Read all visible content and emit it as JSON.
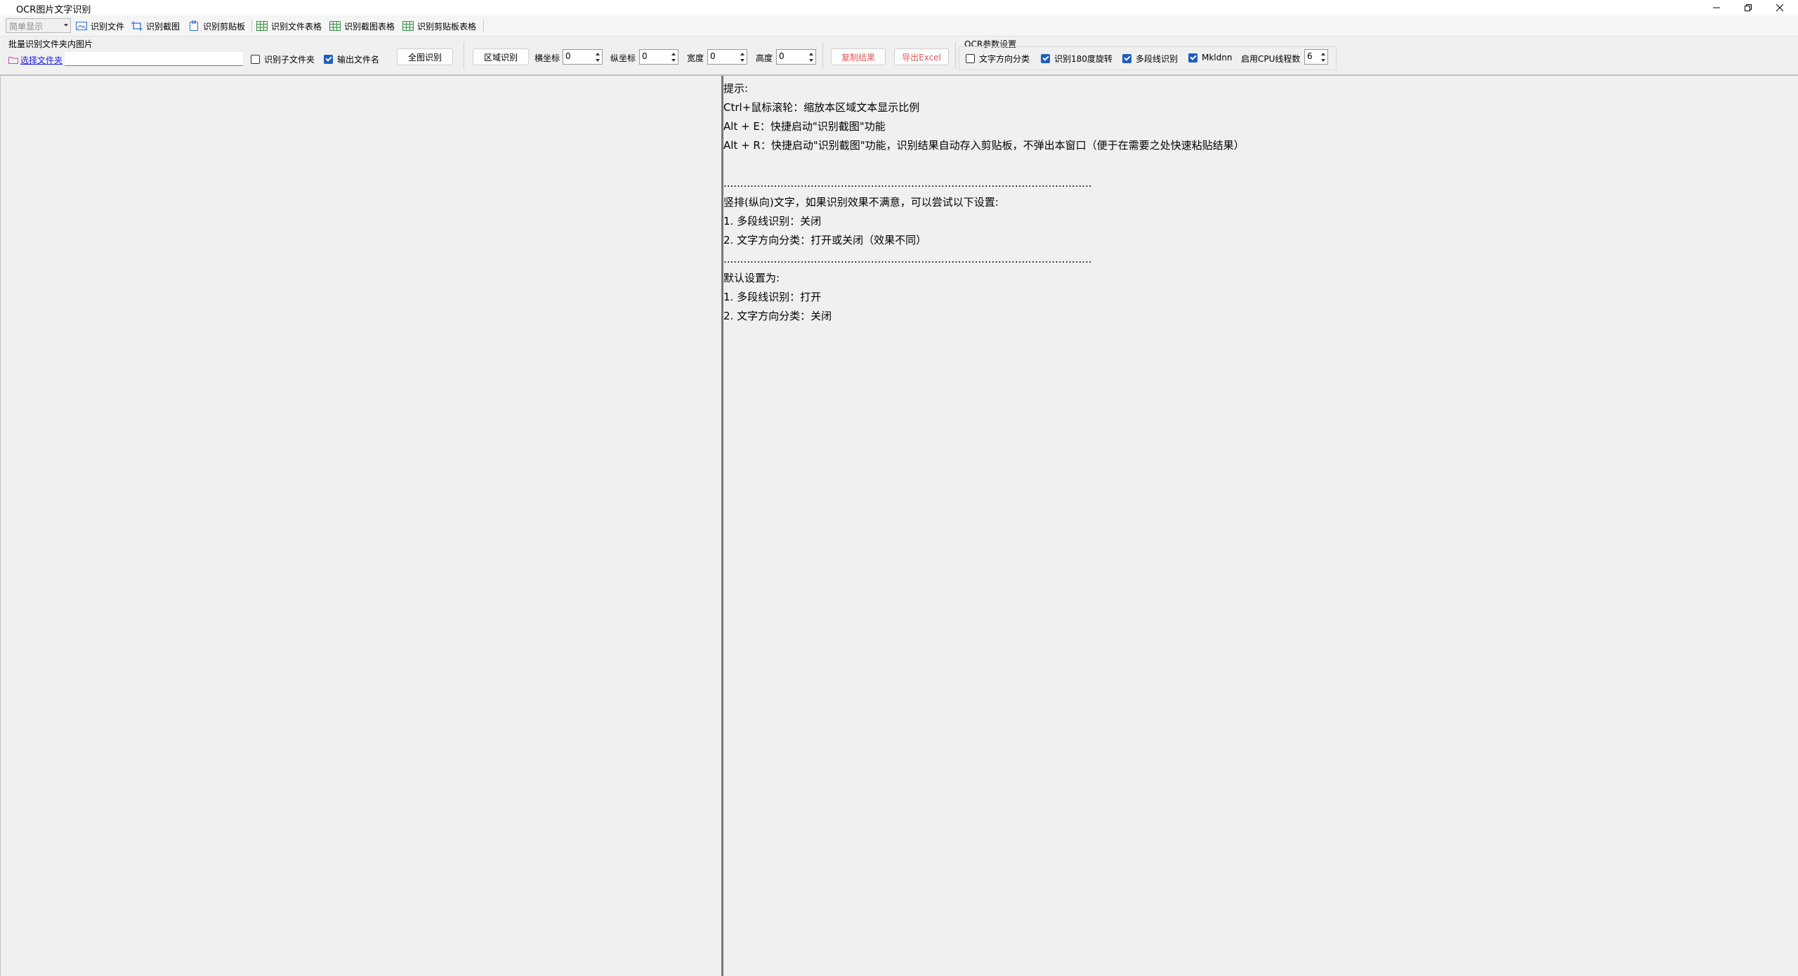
{
  "window": {
    "title": "OCR图片文字识别"
  },
  "toolbar": {
    "mode_select": "简单显示",
    "items": [
      {
        "label": "识别文件",
        "icon": "image-file-icon"
      },
      {
        "label": "识别截图",
        "icon": "screenshot-crop-icon"
      },
      {
        "label": "识别剪贴板",
        "icon": "clipboard-icon"
      },
      {
        "label": "识别文件表格",
        "icon": "table-icon"
      },
      {
        "label": "识别截图表格",
        "icon": "table-icon"
      },
      {
        "label": "识别剪贴板表格",
        "icon": "table-icon"
      }
    ]
  },
  "batch": {
    "group_label": "批量识别文件夹内图片",
    "choose_folder": "选择文件夹",
    "path_value": "",
    "include_subfolders": {
      "label": "识别子文件夹",
      "checked": false
    },
    "output_filename": {
      "label": "输出文件名",
      "checked": true
    },
    "recognize_all": "全图识别"
  },
  "region": {
    "button": "区域识别",
    "x_label": "横坐标",
    "x_value": "0",
    "y_label": "纵坐标",
    "y_value": "0",
    "w_label": "宽度",
    "w_value": "0",
    "h_label": "高度",
    "h_value": "0"
  },
  "actions": {
    "copy_result": "复制结果",
    "export_excel": "导出Excel"
  },
  "ocr_params": {
    "group_label": "OCR参数设置",
    "text_direction": {
      "label": "文字方向分类",
      "checked": false
    },
    "rotate180": {
      "label": "识别180度旋转",
      "checked": true
    },
    "multiline": {
      "label": "多段线识别",
      "checked": true
    },
    "mkldnn": {
      "label": "Mkldnn",
      "checked": true
    },
    "cpu_threads_label": "启用CPU线程数",
    "cpu_threads_value": "6"
  },
  "result": {
    "lines": [
      "提示:",
      "Ctrl+鼠标滚轮：缩放本区域文本显示比例",
      "Alt + E：快捷启动\"识别截图\"功能",
      "Alt + R：快捷启动\"识别截图\"功能，识别结果自动存入剪贴板，不弹出本窗口（便于在需要之处快速粘贴结果）",
      "",
      "..............................................................................................................",
      "竖排(纵向)文字，如果识别效果不满意，可以尝试以下设置:",
      "1. 多段线识别：关闭",
      "2. 文字方向分类：打开或关闭（效果不同）",
      "..............................................................................................................",
      "默认设置为:",
      "1. 多段线识别：打开",
      "2. 文字方向分类：关闭"
    ]
  },
  "colors": {
    "link": "#1a1ae6",
    "checkbox_on": "#1f5fbf",
    "red_button_text": "#e05a5a",
    "splitter": "#777777"
  }
}
